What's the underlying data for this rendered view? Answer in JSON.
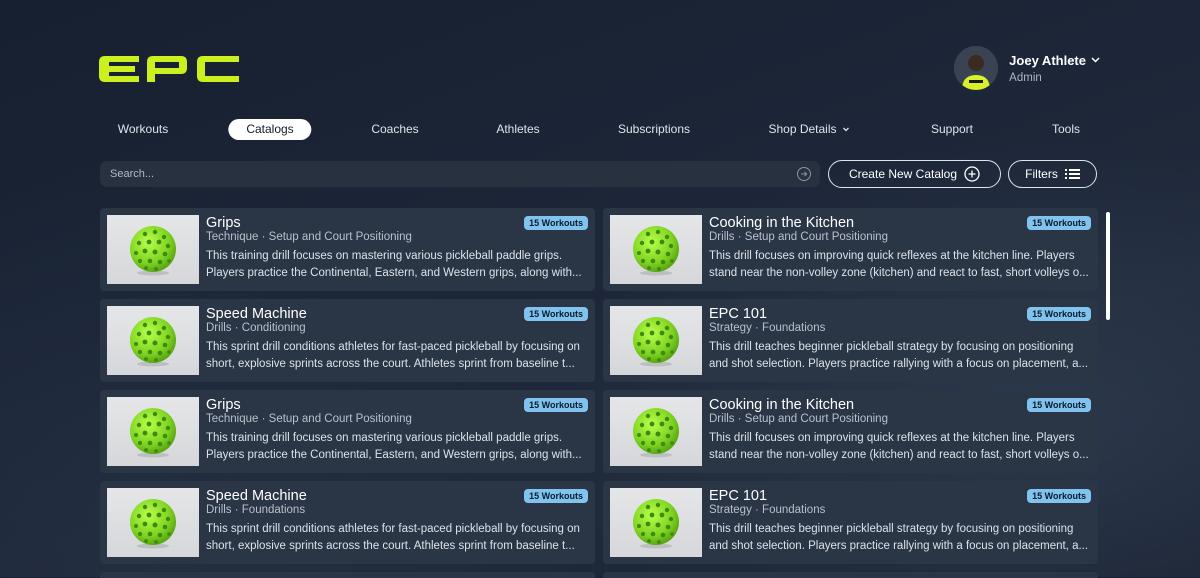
{
  "brand": {
    "logo_text": "EPC",
    "accent_color": "#ccef1f"
  },
  "user": {
    "name": "Joey Athlete",
    "role": "Admin"
  },
  "nav": {
    "items": [
      {
        "label": "Workouts"
      },
      {
        "label": "Catalogs",
        "active": true
      },
      {
        "label": "Coaches"
      },
      {
        "label": "Athletes"
      },
      {
        "label": "Subscriptions"
      },
      {
        "label": "Shop Details",
        "has_dropdown": true
      },
      {
        "label": "Support"
      },
      {
        "label": "Tools"
      }
    ]
  },
  "toolbar": {
    "search_placeholder": "Search...",
    "create_label": "Create New Catalog",
    "filters_label": "Filters"
  },
  "cards": [
    {
      "title": "Grips",
      "subtitle": "Technique · Setup and Court Positioning",
      "badge": "15 Workouts",
      "line1": "This training drill focuses on mastering various pickleball paddle grips.",
      "line2": "Players practice the Continental, Eastern, and Western grips, along with..."
    },
    {
      "title": "Cooking in the Kitchen",
      "subtitle": "Drills · Setup and Court Positioning",
      "badge": "15 Workouts",
      "line1": "This drill focuses on improving quick reflexes at the kitchen line. Players",
      "line2": "stand near the non-volley zone (kitchen) and react to fast, short volleys o..."
    },
    {
      "title": "Speed Machine",
      "subtitle": "Drills · Conditioning",
      "badge": "15 Workouts",
      "line1": "This sprint drill conditions athletes for fast-paced pickleball by focusing on",
      "line2": "short, explosive sprints across the court. Athletes sprint from baseline t..."
    },
    {
      "title": "EPC 101",
      "subtitle": "Strategy  · Foundations",
      "badge": "15 Workouts",
      "line1": "This drill teaches beginner pickleball strategy by focusing on positioning",
      "line2": "and shot selection. Players practice rallying with a focus on placement, a..."
    },
    {
      "title": "Grips",
      "subtitle": "Technique · Setup and Court Positioning",
      "badge": "15 Workouts",
      "line1": "This training drill focuses on mastering various pickleball paddle grips.",
      "line2": "Players practice the Continental, Eastern, and Western grips, along with..."
    },
    {
      "title": "Cooking in the Kitchen",
      "subtitle": "Drills · Setup and Court Positioning",
      "badge": "15 Workouts",
      "line1": "This drill focuses on improving quick reflexes at the kitchen line. Players",
      "line2": "stand near the non-volley zone (kitchen) and react to fast, short volleys o..."
    },
    {
      "title": "Speed Machine",
      "subtitle": "Drills · Foundations",
      "badge": "15 Workouts",
      "line1": "This sprint drill conditions athletes for fast-paced pickleball by focusing on",
      "line2": "short, explosive sprints across the court. Athletes sprint from baseline t..."
    },
    {
      "title": "EPC 101",
      "subtitle": "Strategy  · Foundations",
      "badge": "15 Workouts",
      "line1": "This drill teaches beginner pickleball strategy by focusing on positioning",
      "line2": "and shot selection. Players practice rallying with a focus on placement, a..."
    }
  ],
  "icons": {
    "search_go": "arrow-right-circle-icon",
    "create": "plus-circle-icon",
    "filters": "list-icon",
    "thumbnail": "pickleball-icon"
  }
}
